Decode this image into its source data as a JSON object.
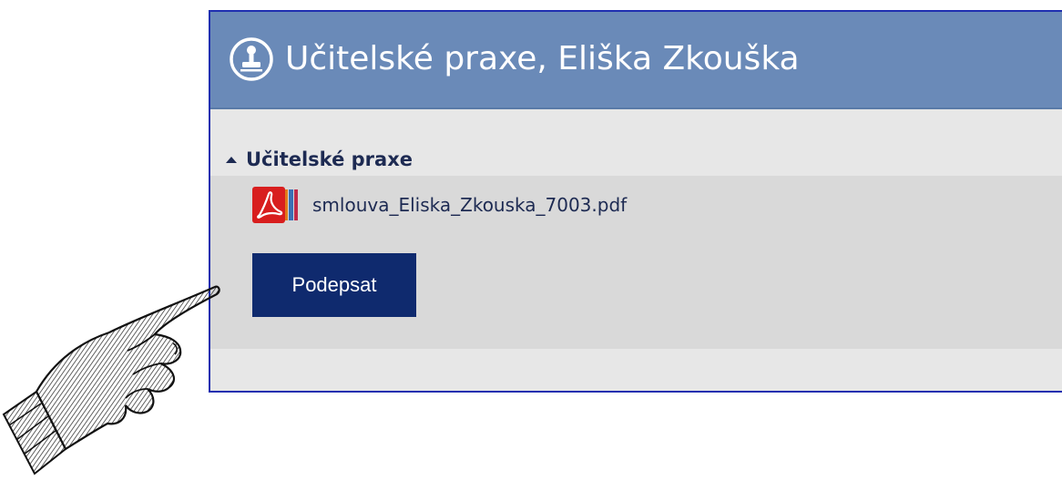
{
  "header": {
    "title": "Učitelské praxe, Eliška Zkouška",
    "icon": "stamp-icon"
  },
  "section": {
    "label": "Učitelské praxe",
    "toggle_icon": "caret-up-icon"
  },
  "file": {
    "name": "smlouva_Eliska_Zkouska_7003.pdf",
    "icon": "pdf-file-icon"
  },
  "actions": {
    "sign_label": "Podepsat"
  },
  "decoration": {
    "pointer": "pointing-hand-illustration"
  },
  "colors": {
    "header_bg": "#6a8ab8",
    "button_bg": "#0f2a6e",
    "text_dark": "#1d2a52",
    "frame_border": "#1f2fb0"
  }
}
